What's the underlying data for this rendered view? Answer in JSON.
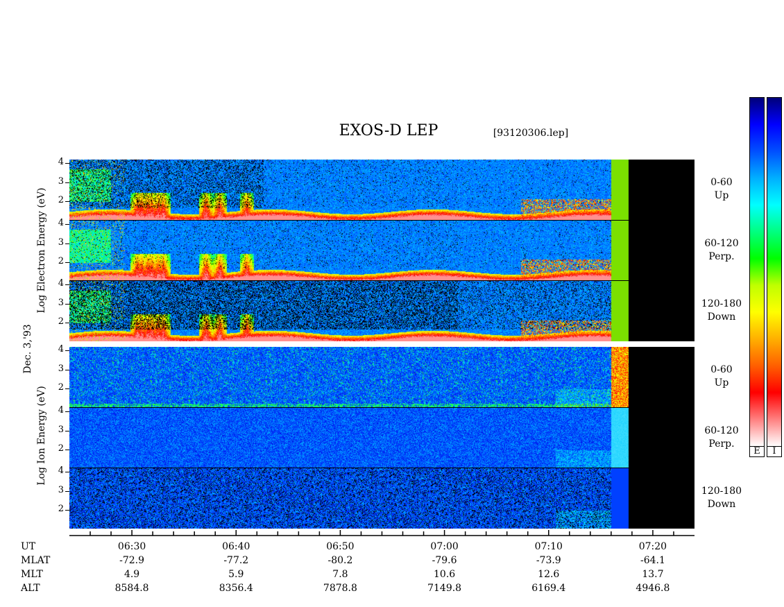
{
  "header": {
    "title": "EXOS-D LEP",
    "file": "[93120306.lep]"
  },
  "side_labels": {
    "date": "Dec. 3,'93",
    "electron_axis": "Log  Electron  Energy (eV)",
    "ion_axis": "Log  Ion  Energy (eV)"
  },
  "panels": [
    {
      "group": "electron",
      "angle": "0-60",
      "direction": "Up"
    },
    {
      "group": "electron",
      "angle": "60-120",
      "direction": "Perp."
    },
    {
      "group": "electron",
      "angle": "120-180",
      "direction": "Down"
    },
    {
      "group": "ion",
      "angle": "0-60",
      "direction": "Up"
    },
    {
      "group": "ion",
      "angle": "60-120",
      "direction": "Perp."
    },
    {
      "group": "ion",
      "angle": "120-180",
      "direction": "Down"
    }
  ],
  "colorbar": {
    "labels": [
      "E",
      "I"
    ],
    "colors_top_to_bottom": [
      "#00007a",
      "#0000ff",
      "#0050ff",
      "#00b0ff",
      "#00ffff",
      "#00ff80",
      "#00ff00",
      "#c0ff00",
      "#ffff00",
      "#ffb000",
      "#ff6000",
      "#ff0000",
      "#ff8080",
      "#ffffff"
    ]
  },
  "chart_data": {
    "type": "heatmap",
    "title": "EXOS-D LEP",
    "ylabel_electron": "Log  Electron  Energy (eV)",
    "ylabel_ion": "Log  Ion  Energy (eV)",
    "y_ticks": [
      "4",
      "3",
      "2"
    ],
    "ylim": [
      1,
      4.2
    ],
    "x_ticks": [
      "06:30",
      "06:40",
      "06:50",
      "07:00",
      "07:10",
      "07:20"
    ],
    "xlim": [
      "06:24",
      "07:24"
    ],
    "data_end": "07:16",
    "orbit": {
      "rows": [
        "UT",
        "MLAT",
        "MLT",
        "ALT"
      ],
      "MLAT": [
        "-72.9",
        "-77.2",
        "-80.2",
        "-79.6",
        "-73.9",
        "-64.1"
      ],
      "MLT": [
        "4.9",
        "5.9",
        "7.8",
        "10.6",
        "12.6",
        "13.7"
      ],
      "ALT": [
        "8584.8",
        "8356.4",
        "7878.8",
        "7149.8",
        "6169.4",
        "4946.8"
      ]
    },
    "calibration_band": {
      "electron": [
        "#7be000",
        "#7be000",
        "#7be000"
      ],
      "ion": [
        "#ffb020",
        "#30d8ff",
        "#0040ff"
      ]
    }
  }
}
